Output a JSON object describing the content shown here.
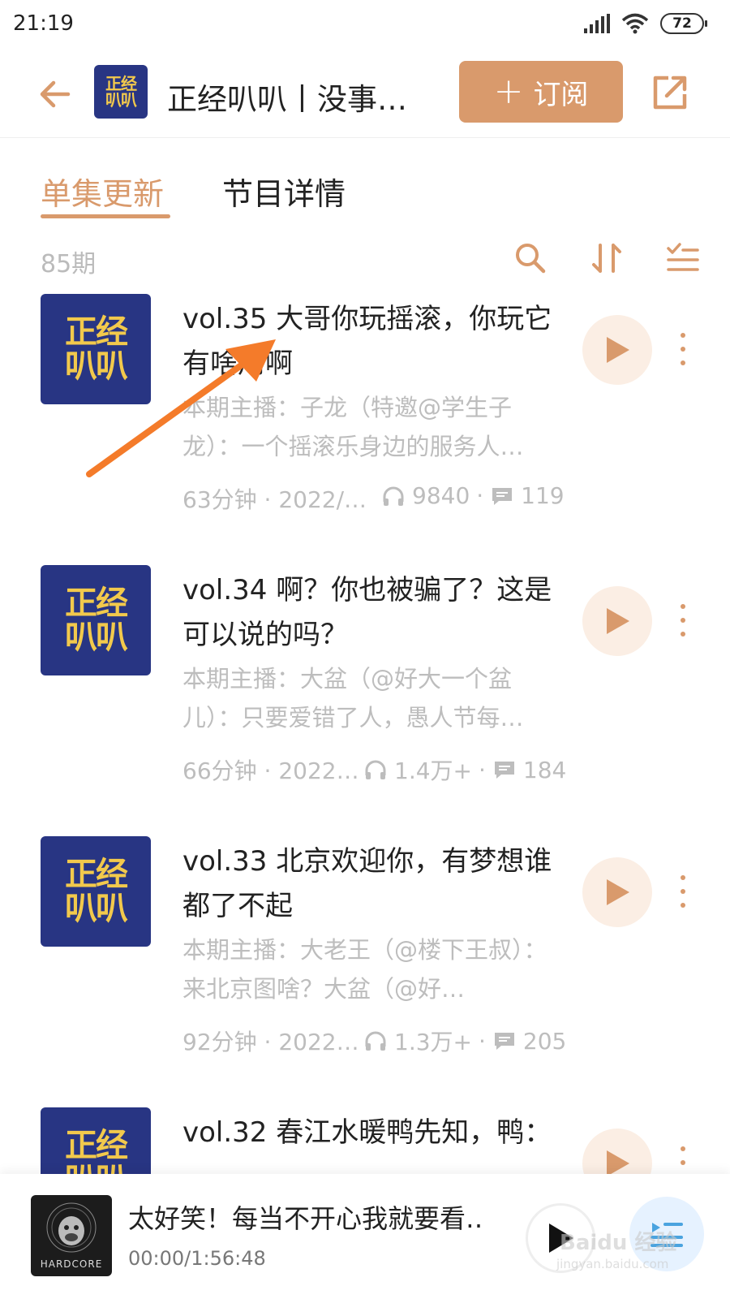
{
  "status_bar": {
    "time": "21:19",
    "battery": "72"
  },
  "header": {
    "podcast_title": "正经叭叭丨没事…",
    "subscribe_label": "订阅",
    "cover_line1": "正经",
    "cover_line2": "叭叭"
  },
  "tabs": [
    {
      "label": "单集更新",
      "active": true
    },
    {
      "label": "节目详情",
      "active": false
    }
  ],
  "list": {
    "count": "85期"
  },
  "episodes": [
    {
      "title": "vol.35 大哥你玩摇滚，你玩它有啥用啊",
      "description": "本期主播：子龙（特邀@学生子龙）：一个摇滚乐身边的服务人…",
      "meta": "63分钟 · 2022/…",
      "plays": "9840",
      "comments": "119"
    },
    {
      "title": "vol.34 啊？你也被骗了？这是可以说的吗？",
      "description": "本期主播：大盆（@好大一个盆儿）：只要爱错了人，愚人节每…",
      "meta": "66分钟 · 2022…",
      "plays": "1.4万+",
      "comments": "184"
    },
    {
      "title": "vol.33 北京欢迎你，有梦想谁都了不起",
      "description": "本期主播：大老王（@楼下王叔）：来北京图啥？大盆（@好…",
      "meta": "92分钟 · 2022…",
      "plays": "1.3万+",
      "comments": "205"
    },
    {
      "title": "vol.32 春江水暖鸭先知，鸭：",
      "description": "",
      "meta": "",
      "plays": "",
      "comments": ""
    }
  ],
  "mini_player": {
    "title": "太好笑！每当不开心我就要看…",
    "time": "00:00/1:56:48",
    "cover_text": "HARDCORE"
  },
  "watermark": {
    "brand": "Baidu 经验",
    "url": "jingyan.baidu.com"
  },
  "colors": {
    "accent": "#d99a6c",
    "cover_bg": "#283583",
    "cover_text": "#f2c94c",
    "annotation_arrow": "#f47b2a"
  }
}
